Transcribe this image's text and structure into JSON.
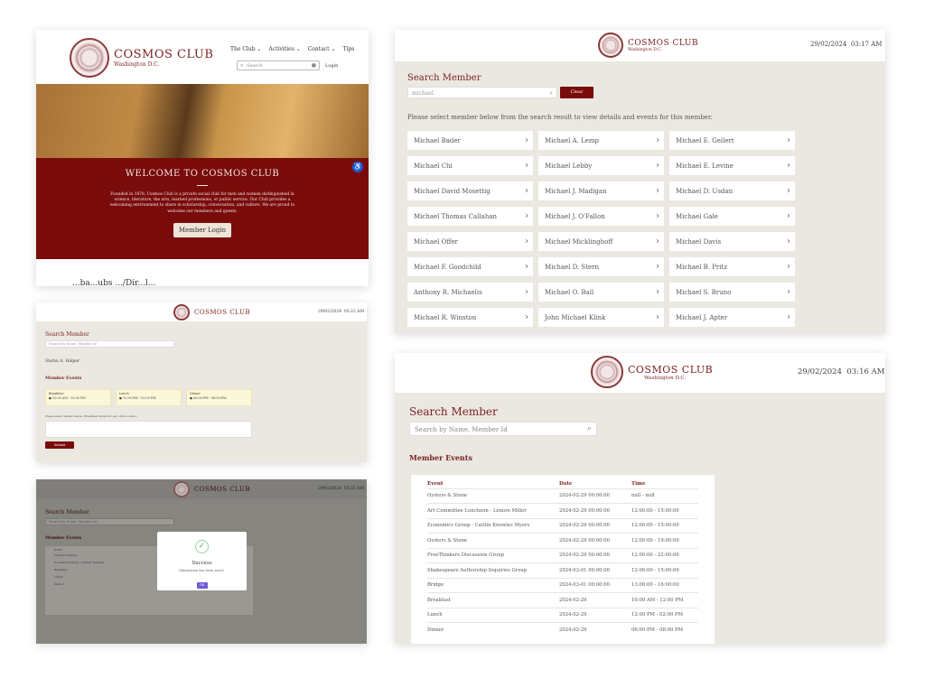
{
  "brand": {
    "title": "COSMOS CLUB",
    "subtitle": "Washington D.C."
  },
  "home": {
    "nav": [
      "The Club",
      "Activities",
      "Contact",
      "Tips"
    ],
    "search_placeholder": "Search",
    "login": "Login",
    "welcome_title": "WELCOME TO COSMOS CLUB",
    "welcome_text": "Founded in 1878, Cosmos Club is a private social club for men and women distinguished in science, literature, the arts, learned professions, or public service. Our Club provides a welcoming environment to share in scholarship, conversation, and culture. We are proud to welcome our members and guests.",
    "member_login": "Member Login",
    "cut_text": "...ba...ubs .../Dir...l..."
  },
  "grid_screen": {
    "date": "29/02/2024",
    "time": "03:17 AM",
    "title": "Search Member",
    "search_value": "michael",
    "clear": "Clear",
    "hint": "Please select member below from the search result to view details and events for this member.",
    "members": [
      "Michael Bader",
      "Michael A. Lemp",
      "Michael E. Gellert",
      "Michael Chi",
      "Michael Lebby",
      "Michael E. Levine",
      "Michael David Mosettig",
      "Michael J. Madigan",
      "Michael D. Usdan",
      "Michael Thomas Callahan",
      "Michael J. O'Fallon",
      "Michael Gale",
      "Michael Offer",
      "Michael Micklinghoff",
      "Michael Davis",
      "Michael F. Goodchild",
      "Michael D. Stern",
      "Michael B. Pritz",
      "Anthony R. Michaelis",
      "Michael O. Ball",
      "Michael S. Bruno",
      "Michael R. Winston",
      "John Michael Klink",
      "Michael J. Apter"
    ]
  },
  "detail_screen": {
    "date": "29/02/2024",
    "time": "03:22 AM",
    "title": "Search Member",
    "search_placeholder": "Search by Name, Member Id",
    "selected_member": "Stefan A. Halper",
    "member_events": "Member Events",
    "events": [
      {
        "name": "Breakfast",
        "time": "10:00 AM - 12:00 PM"
      },
      {
        "name": "Lunch",
        "time": "12:00 PM - 02:00 PM"
      },
      {
        "name": "Dinner",
        "time": "06:00 PM - 08:00 PM"
      }
    ],
    "note": "Please select details below. (Breakfast fasted for any other events.)",
    "submit": "Submit"
  },
  "modal_screen": {
    "date": "29/02/2024",
    "time": "03:22 AM",
    "title": "Search Member",
    "search_placeholder": "Search by Name, Member Id",
    "member_events": "Member Events",
    "rows": [
      "Event",
      "Oysters & Stone",
      "Economics Group - Cardiac Nursing",
      "Breakfast",
      "Lunch",
      "Dinner"
    ],
    "modal_title": "Success",
    "modal_text": "Information has been saved.",
    "ok": "OK"
  },
  "events_screen": {
    "date": "29/02/2024",
    "time": "03:16 AM",
    "title": "Search Member",
    "search_placeholder": "Search by Name, Member Id",
    "member_events": "Member Events",
    "columns": [
      "Event",
      "Date",
      "Time"
    ],
    "rows": [
      [
        "Oysters & Stone",
        "2024-02-29 00:00:00",
        "null - null"
      ],
      [
        "Art Committee Luncheon - Lenore Miller",
        "2024-02-29 00:00:00",
        "12:00:00 - 15:00:00"
      ],
      [
        "Economics Group - Caitlin Knowles Myers",
        "2024-02-29 00:00:00",
        "12:00:00 - 15:00:00"
      ],
      [
        "Oysters & Stone",
        "2024-02-29 00:00:00",
        "12:00:00 - 19:00:00"
      ],
      [
        "FreeThinkers Discussion Group",
        "2024-02-29 00:00:00",
        "12:00:00 - 22:00:00"
      ],
      [
        "Shakespeare Authorship Inquiries Group",
        "2024-03-01 00:00:00",
        "12:00:00 - 15:00:00"
      ],
      [
        "Bridge",
        "2024-03-01 00:00:00",
        "13:00:00 - 16:00:00"
      ],
      [
        "Breakfast",
        "2024-02-29",
        "10:00 AM - 12:00 PM"
      ],
      [
        "Lunch",
        "2024-02-29",
        "12:00 PM - 02:00 PM"
      ],
      [
        "Dinner",
        "2024-02-29",
        "06:00 PM - 08:00 PM"
      ]
    ]
  }
}
